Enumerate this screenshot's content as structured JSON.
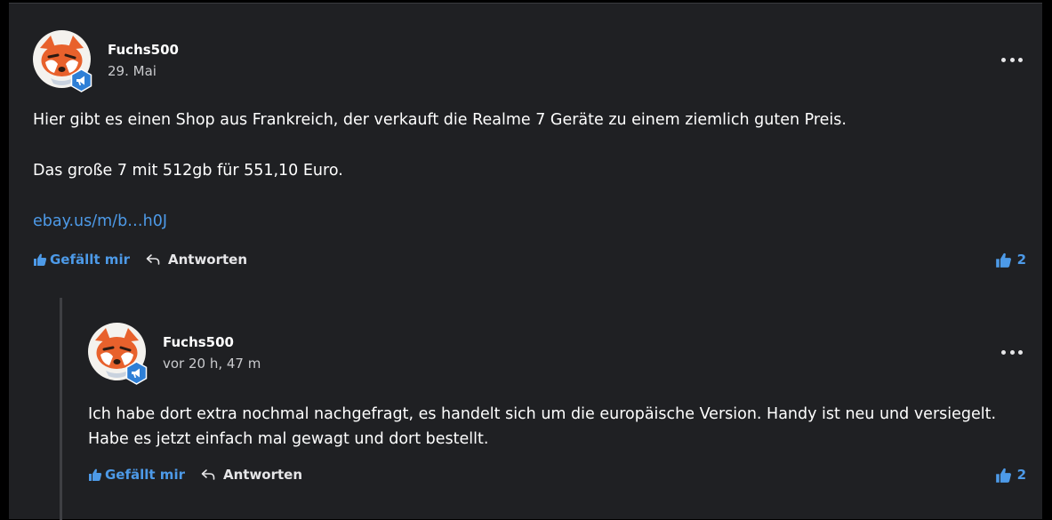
{
  "colors": {
    "background": "#1f2023",
    "accent": "#4d9ae8",
    "text": "#ffffff",
    "muted": "#c9cacd"
  },
  "comments": [
    {
      "author": "Fuchs500",
      "date": "29. Mai",
      "avatar_icon": "fox-avatar",
      "badge_icon": "megaphone-badge-icon",
      "paragraphs": [
        "Hier gibt es einen Shop aus Frankreich, der verkauft die Realme 7 Geräte zu einem ziemlich guten Preis.",
        "Das große 7 mit 512gb für 551,10 Euro."
      ],
      "link": "ebay.us/m/b…h0J",
      "like_label": "Gefällt mir",
      "reply_label": "Antworten",
      "like_count": "2"
    },
    {
      "author": "Fuchs500",
      "date": "vor 20 h, 47 m",
      "avatar_icon": "fox-avatar",
      "badge_icon": "megaphone-badge-icon",
      "paragraphs": [
        "Ich habe dort extra nochmal nachgefragt, es handelt sich um die europäische Version. Handy ist neu und versiegelt.",
        "Habe es jetzt einfach mal gewagt und dort bestellt."
      ],
      "like_label": "Gefällt mir",
      "reply_label": "Antworten",
      "like_count": "2"
    }
  ]
}
